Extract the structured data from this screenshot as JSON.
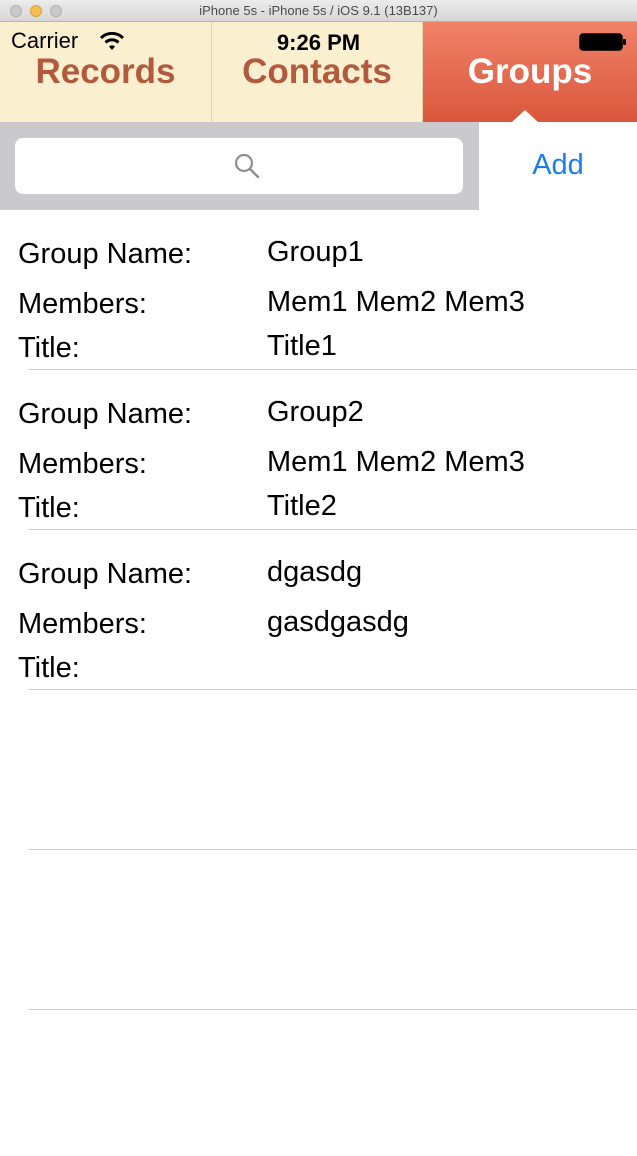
{
  "window": {
    "title": "iPhone 5s - iPhone 5s / iOS 9.1 (13B137)"
  },
  "status_bar": {
    "carrier": "Carrier",
    "time": "9:26 PM",
    "wifi_icon": "wifi-icon",
    "battery_icon": "battery-icon"
  },
  "tabs": [
    {
      "label": "Records",
      "selected": false
    },
    {
      "label": "Contacts",
      "selected": false
    },
    {
      "label": "Groups",
      "selected": true
    }
  ],
  "colors": {
    "tab_bg": "#faf0d0",
    "tab_text": "#b35a3e",
    "tab_selected_bg": "#e36a4f",
    "link": "#1a7ef0",
    "search_area_bg": "#c9c9ce"
  },
  "search": {
    "placeholder": "",
    "icon": "search-icon"
  },
  "add_button": {
    "label": "Add"
  },
  "labels": {
    "group_name": "Group Name:",
    "members": "Members:",
    "title": "Title:"
  },
  "groups": [
    {
      "name": "Group1",
      "members": "Mem1 Mem2 Mem3",
      "title": "Title1"
    },
    {
      "name": "Group2",
      "members": "Mem1 Mem2 Mem3",
      "title": "Title2"
    },
    {
      "name": "dgasdg",
      "members": "gasdgasdg",
      "title": ""
    }
  ]
}
